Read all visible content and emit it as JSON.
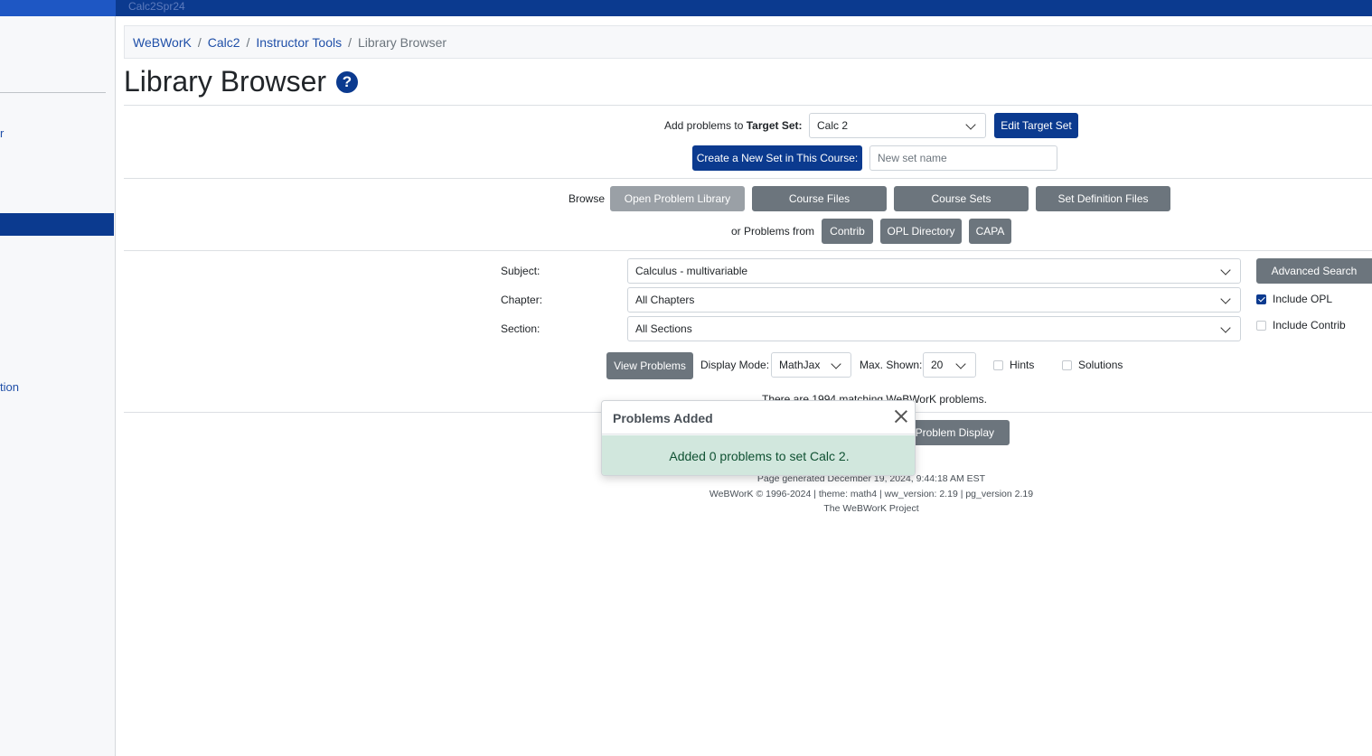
{
  "topbar": {
    "text": "Calc2Spr24"
  },
  "sidebar": {
    "frag_r": "r",
    "frag_tion": "tion"
  },
  "breadcrumb": {
    "items": [
      "WeBWorK",
      "Calc2",
      "Instructor Tools"
    ],
    "current": "Library Browser",
    "separator": "/"
  },
  "page": {
    "title": "Library Browser",
    "help_icon": "?"
  },
  "target": {
    "label_prefix": "Add problems to",
    "label_bold": "Target Set:",
    "selected": "Calc 2",
    "edit_button": "Edit Target Set",
    "create_button": "Create a New Set in This Course:",
    "new_set_placeholder": "New set name"
  },
  "browse": {
    "label": "Browse",
    "buttons": [
      "Open Problem Library",
      "Course Files",
      "Course Sets",
      "Set Definition Files"
    ],
    "or_label": "or Problems from",
    "sources": [
      "Contrib",
      "OPL Directory",
      "CAPA"
    ]
  },
  "filters": {
    "subject_label": "Subject:",
    "subject_value": "Calculus - multivariable",
    "chapter_label": "Chapter:",
    "chapter_value": "All Chapters",
    "section_label": "Section:",
    "section_value": "All Sections",
    "advanced_button": "Advanced Search",
    "include_opl": "Include OPL",
    "include_contrib": "Include Contrib"
  },
  "view": {
    "view_button": "View Problems",
    "display_mode_label": "Display Mode:",
    "display_mode_value": "MathJax",
    "max_shown_label": "Max. Shown:",
    "max_shown_value": "20",
    "hints_label": "Hints",
    "solutions_label": "Solutions"
  },
  "results": {
    "matching_text": "There are 1994 matching WeBWorK problems.",
    "problem_display_button": "Problem Display"
  },
  "footer": {
    "generated": "Page generated December 19, 2024, 9:44:18 AM EST",
    "version": "WeBWorK © 1996-2024 | theme: math4 | ww_version: 2.19 | pg_version 2.19",
    "project": "The WeBWorK Project"
  },
  "toast": {
    "title": "Problems Added",
    "message": "Added 0 problems to set Calc 2."
  },
  "colors": {
    "primary": "#0b3a8f",
    "secondary": "#6c757d",
    "success_bg": "#d1e7dd"
  }
}
